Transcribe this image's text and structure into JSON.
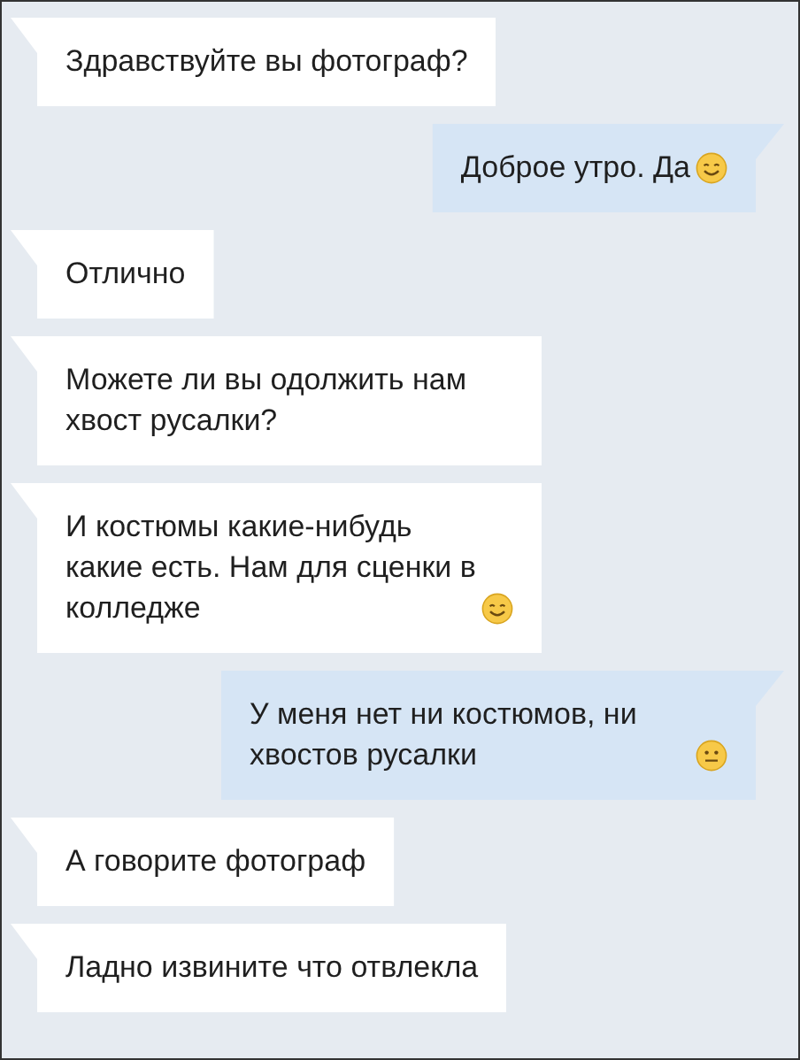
{
  "messages": [
    {
      "kind": "incoming",
      "text": "Здравствуйте вы фотограф?"
    },
    {
      "kind": "outgoing",
      "text": "Доброе утро. Да",
      "emoji": {
        "kind": "smile"
      }
    },
    {
      "kind": "incoming",
      "text": "Отлично"
    },
    {
      "kind": "incoming",
      "text": "Можете ли вы одолжить нам хвост русалки?"
    },
    {
      "kind": "incoming",
      "text": "И костюмы какие-нибудь какие есть. Нам для сценки в колледже",
      "emoji": {
        "kind": "smile"
      }
    },
    {
      "kind": "outgoing",
      "text": "У меня нет ни костюмов, ни хвостов русалки",
      "emoji": {
        "kind": "neutral"
      }
    },
    {
      "kind": "incoming",
      "text": "А говорите фотограф"
    },
    {
      "kind": "incoming",
      "text": "Ладно извините что отвлекла"
    }
  ]
}
